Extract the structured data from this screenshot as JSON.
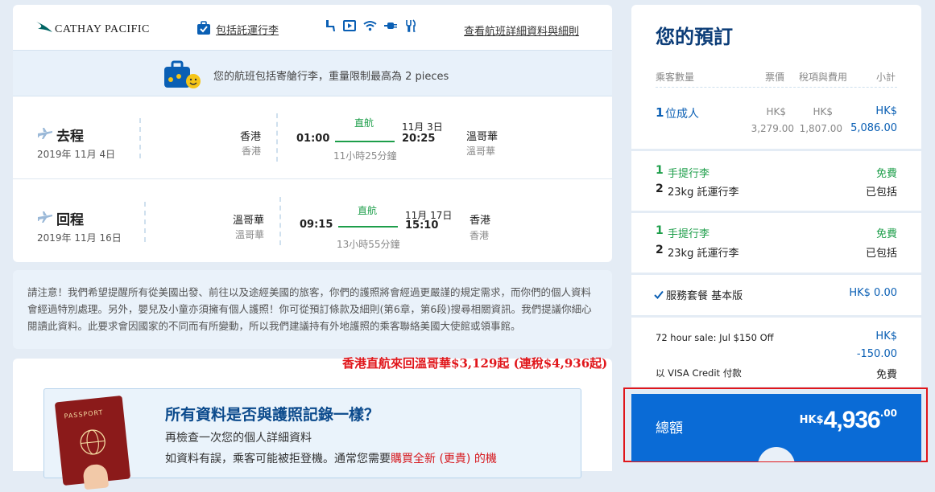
{
  "header": {
    "logo_text": "CATHAY PACIFIC",
    "baggage_link": "包括託運行李",
    "details_link": "查看航班詳細資料與細則",
    "amenity_icons": [
      "seat-icon",
      "screen-icon",
      "wifi-icon",
      "power-icon",
      "meal-icon"
    ]
  },
  "baggage_banner": {
    "text": "您的航班包括寄艙行李，重量限制最高為 2 pieces"
  },
  "outbound": {
    "label": "去程",
    "date": "2019年 11月 4日",
    "from_city": "香港",
    "from_airport": "香港",
    "dep_time": "01:00",
    "direct": "直航",
    "arr_date": "11月 3日",
    "arr_time": "20:25",
    "duration": "11小時25分鐘",
    "to_city": "溫哥華",
    "to_airport": "溫哥華"
  },
  "inbound": {
    "label": "回程",
    "date": "2019年 11月 16日",
    "from_city": "溫哥華",
    "from_airport": "溫哥華",
    "dep_time": "09:15",
    "direct": "直航",
    "arr_date": "11月 17日",
    "arr_time": "15:10",
    "duration": "13小時55分鐘",
    "to_city": "香港",
    "to_airport": "香港"
  },
  "notice": {
    "text": "請注意！我們希望提醒所有從美國出發、前往以及途經美國的旅客，你們的護照將會經過更嚴謹的規定需求，而你們的個人資料會經過特別處理。另外，嬰兒及小童亦須擁有個人護照！你可從預訂條款及細則(第6章，第6段)搜尋相關資訊。我們提議你細心閱讀此資料。此要求會因國家的不同而有所變動，所以我們建議持有外地護照的乘客聯絡美國大使館或領事館。"
  },
  "promo": {
    "text": "香港直航來回溫哥華$3,129起 (連稅$4,936起)"
  },
  "passport_card": {
    "passport_word": "PASSPORT",
    "title": "所有資料是否與護照記錄一樣？",
    "line1": "再檢查一次您的個人詳細資料",
    "line2_prefix": "如資料有誤，乘客可能被拒登機。通常您需要",
    "line2_highlight": "購買全新 (更貴) 的機"
  },
  "summary": {
    "title": "您的預訂",
    "headers": {
      "passengers": "乘客數量",
      "fare": "票價",
      "taxes": "稅項與費用",
      "subtotal": "小計"
    },
    "adult": {
      "count": "1",
      "label": "位成人",
      "fare_cur": "HK$",
      "fare": "3,279.00",
      "tax_cur": "HK$",
      "tax": "1,807.00",
      "sub_cur": "HK$",
      "sub": "5,086.00"
    },
    "baggage_blocks": [
      {
        "carry_count": "1",
        "carry_label": "手提行李",
        "carry_price": "免費",
        "check_count": "2",
        "check_label": "23kg 託運行李",
        "check_price": "已包括"
      },
      {
        "carry_count": "1",
        "carry_label": "手提行李",
        "carry_price": "免費",
        "check_count": "2",
        "check_label": "23kg 託運行李",
        "check_price": "已包括"
      }
    ],
    "service": {
      "label": "服務套餐 基本版",
      "price": "HK$ 0.00"
    },
    "discount": {
      "label": "72 hour sale: Jul $150 Off",
      "cur": "HK$",
      "amount": "-150.00"
    },
    "visa": {
      "label": "以 VISA Credit 付款",
      "price": "免費"
    },
    "total": {
      "label": "總額",
      "cur": "HK$",
      "amount": "4,936",
      "cents": ".00"
    }
  },
  "colors": {
    "brand_green": "#006564",
    "primary_blue": "#0a5fb4",
    "total_bg": "#0a6bd6",
    "highlight_red": "#e0161b",
    "free_green": "#1d9e4a"
  }
}
